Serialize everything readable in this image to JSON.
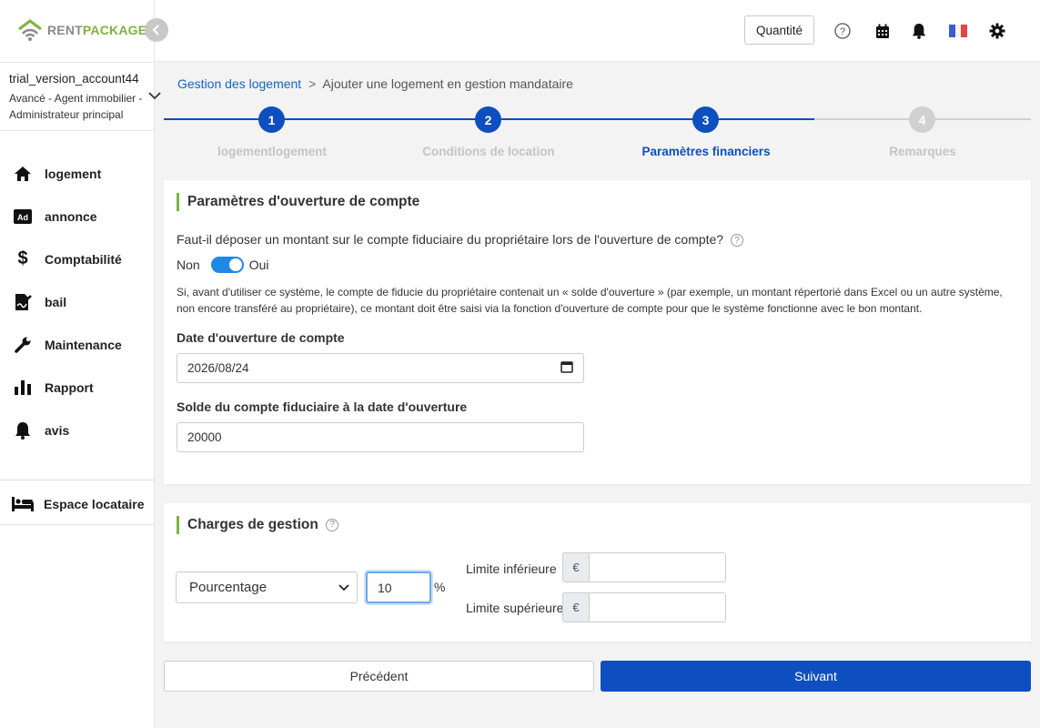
{
  "brand": {
    "part1": "RENT",
    "part2": "PACKAGE"
  },
  "account": {
    "name": "trial_version_account44",
    "role": "Avancé - Agent immobilier - Administrateur principal"
  },
  "sidebar": {
    "items": [
      {
        "label": "logement",
        "icon": "home-icon"
      },
      {
        "label": "annonce",
        "icon": "ad-icon"
      },
      {
        "label": "Comptabilité",
        "icon": "dollar-icon"
      },
      {
        "label": "bail",
        "icon": "contract-icon"
      },
      {
        "label": "Maintenance",
        "icon": "wrench-icon"
      },
      {
        "label": "Rapport",
        "icon": "bar-chart-icon"
      },
      {
        "label": "avis",
        "icon": "bell-icon"
      }
    ],
    "tenant_space": "Espace locataire"
  },
  "topbar": {
    "quantity_label": "Quantité"
  },
  "breadcrumb": {
    "parent": "Gestion des logement",
    "separator": ">",
    "current": "Ajouter une logement en gestion mandataire"
  },
  "stepper": {
    "steps": [
      {
        "number": "1",
        "label": "logementlogement",
        "state": "done"
      },
      {
        "number": "2",
        "label": "Conditions de location",
        "state": "done"
      },
      {
        "number": "3",
        "label": "Paramètres financiers",
        "state": "active"
      },
      {
        "number": "4",
        "label": "Remarques",
        "state": "pending"
      }
    ],
    "colors": {
      "active": "#0d4fbf",
      "inactive": "#d0d0d0",
      "label_inactive": "#c4c4c4"
    }
  },
  "opening": {
    "title": "Paramètres d'ouverture de compte",
    "question": "Faut-il déposer un montant sur le compte fiduciaire du propriétaire lors de l'ouverture de compte?",
    "toggle_off": "Non",
    "toggle_on": "Oui",
    "toggle_value": true,
    "note": "Si, avant d'utiliser ce système, le compte de fiducie du propriétaire contenait un « solde d'ouverture » (par exemple, un montant répertorié dans Excel ou un autre système, non encore transféré au propriétaire), ce montant doit être saisi via la fonction d'ouverture de compte pour que le système fonctionne avec le bon montant.",
    "date_label": "Date d'ouverture de compte",
    "date_value": "2026/08/24",
    "balance_label": "Solde du compte fiduciaire à la date d'ouverture",
    "balance_value": "20000"
  },
  "charges": {
    "title": "Charges de gestion",
    "type_value": "Pourcentage",
    "percent_value": "10",
    "percent_sign": "%",
    "lower_label": "Limite inférieure",
    "upper_label": "Limite supérieure",
    "currency": "€",
    "lower_value": "",
    "upper_value": ""
  },
  "buttons": {
    "previous": "Précédent",
    "next": "Suivant"
  },
  "accent": {
    "brand_green": "#7cb342",
    "primary_blue": "#0d4fbf",
    "link_blue": "#1565c0"
  }
}
